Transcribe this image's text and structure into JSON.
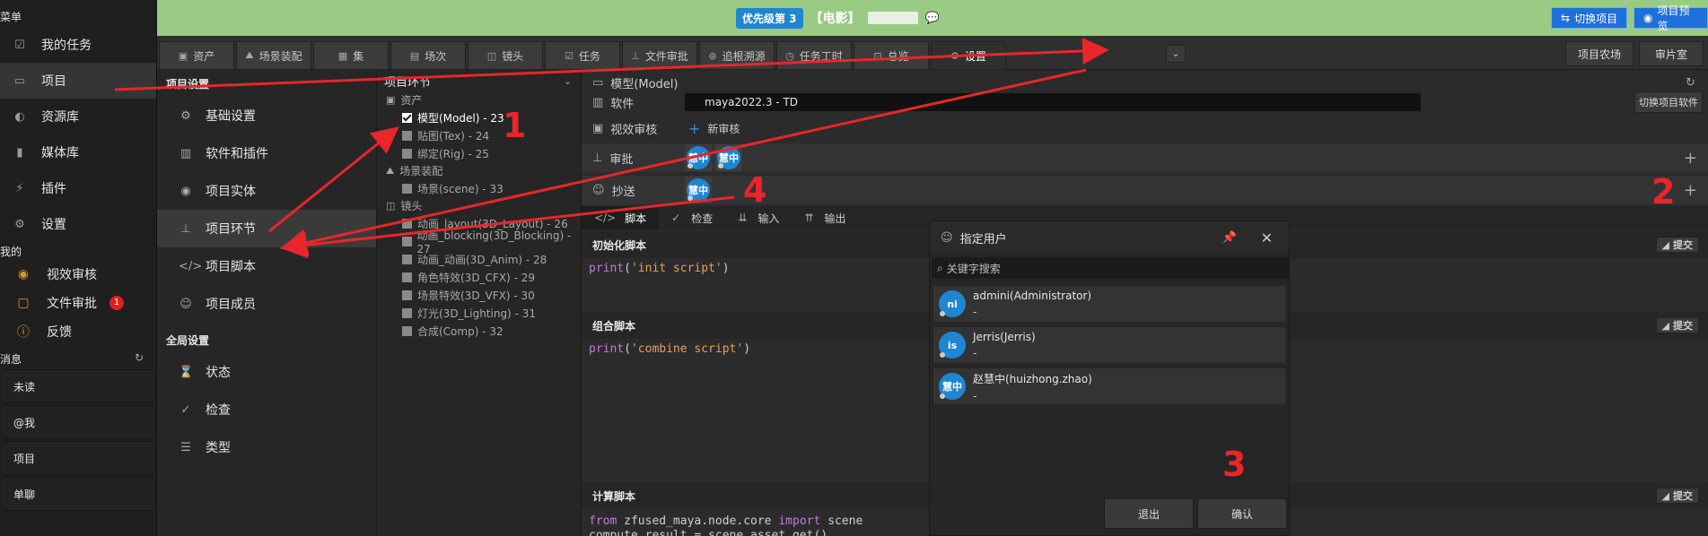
{
  "left_nav": {
    "menu_header": "菜单",
    "items": [
      {
        "label": "我的任务",
        "icon": "checkbox-icon"
      },
      {
        "label": "项目",
        "icon": "window-icon"
      },
      {
        "label": "资源库",
        "icon": "globe-icon"
      },
      {
        "label": "媒体库",
        "icon": "media-icon"
      },
      {
        "label": "插件",
        "icon": "plug-icon"
      },
      {
        "label": "设置",
        "icon": "gear-icon"
      }
    ],
    "mine_header": "我的",
    "mine_items": [
      {
        "label": "视效审核",
        "icon": "eye-icon"
      },
      {
        "label": "文件审批",
        "icon": "folder-icon",
        "badge": "1"
      },
      {
        "label": "反馈",
        "icon": "info-icon"
      }
    ],
    "msg_header": "消息",
    "msg_items": [
      "未读",
      "@我",
      "项目",
      "单聊"
    ]
  },
  "top_bar": {
    "priority_label": "优先级第 3",
    "title": "【电影】",
    "switch_project": "切换项目",
    "project_preview": "项目预览"
  },
  "tabs": [
    {
      "label": "资产",
      "icon": "box-icon"
    },
    {
      "label": "场景装配",
      "icon": "mountain-icon"
    },
    {
      "label": "集",
      "icon": "film-icon"
    },
    {
      "label": "场次",
      "icon": "clapper-icon"
    },
    {
      "label": "镜头",
      "icon": "camera-icon"
    },
    {
      "label": "任务",
      "icon": "check-icon"
    },
    {
      "label": "文件审批",
      "icon": "stamp-icon"
    },
    {
      "label": "追根溯源",
      "icon": "trace-icon"
    },
    {
      "label": "任务工时",
      "icon": "clock-icon"
    },
    {
      "label": "总览",
      "icon": "overview-icon"
    },
    {
      "label": "设置",
      "icon": "gear-icon"
    }
  ],
  "right_buttons": [
    "项目农场",
    "审片室"
  ],
  "settings_panel": {
    "project_header": "项目设置",
    "project_items": [
      {
        "label": "基础设置",
        "icon": "gear-icon"
      },
      {
        "label": "软件和插件",
        "icon": "bar-chart-icon"
      },
      {
        "label": "项目实体",
        "icon": "entity-icon"
      },
      {
        "label": "项目环节",
        "icon": "flow-icon"
      },
      {
        "label": "项目脚本",
        "icon": "code-icon"
      },
      {
        "label": "项目成员",
        "icon": "members-icon"
      }
    ],
    "global_header": "全局设置",
    "global_items": [
      {
        "label": "状态",
        "icon": "hourglass-icon"
      },
      {
        "label": "检查",
        "icon": "check-circle-icon"
      },
      {
        "label": "类型",
        "icon": "list-icon"
      }
    ]
  },
  "phase_tree": {
    "header": "项目环节",
    "groups": [
      {
        "label": "资产",
        "items": [
          "模型(Model) - 23",
          "贴图(Tex) - 24",
          "绑定(Rig) - 25"
        ]
      },
      {
        "label": "场景装配",
        "items": [
          "场景(scene) - 33"
        ]
      },
      {
        "label": "镜头",
        "items": [
          "动画_layout(3D_Layout) - 26",
          "动画_blocking(3D_Blocking) - 27",
          "动画_动画(3D_Anim) - 28",
          "角色特效(3D_CFX) - 29",
          "场景特效(3D_VFX) - 30",
          "灯光(3D_Lighting) - 31",
          "合成(Comp) - 32"
        ]
      }
    ],
    "checked_item": "模型(Model) - 23"
  },
  "main": {
    "header": "模型(Model)",
    "software_label": "软件",
    "software_value": "maya2022.3 - TD",
    "switch_software": "切换项目软件",
    "vfx_review_label": "视效审核",
    "new_review": "新审核",
    "approve_label": "审批",
    "cc_label": "抄送",
    "avatar_text": "慧中",
    "script_tabs": [
      "脚本",
      "检查",
      "输入",
      "输出"
    ],
    "scripts": [
      {
        "title": "初始化脚本",
        "code_fn": "print",
        "code_str": "'init script'"
      },
      {
        "title": "组合脚本",
        "code_fn": "print",
        "code_str": "'combine script'"
      },
      {
        "title": "计算脚本",
        "code_line1_kw1": "from",
        "code_line1_mod": "zfused_maya.node.core",
        "code_line1_kw2": "import",
        "code_line1_name": "scene",
        "code_line2": "compute_result = scene.asset_get()"
      }
    ],
    "submit": "提交"
  },
  "dialog": {
    "title": "指定用户",
    "search_placeholder": "关键字搜索",
    "users": [
      {
        "avatar": "ni",
        "name": "admini(Administrator)",
        "sub": "-"
      },
      {
        "avatar": "is",
        "name": "Jerris(Jerris)",
        "sub": "-"
      },
      {
        "avatar": "慧中",
        "name": "赵慧中(huizhong.zhao)",
        "sub": "-"
      }
    ],
    "exit": "退出",
    "confirm": "确认"
  },
  "annotations": [
    "1",
    "2",
    "3",
    "4"
  ],
  "colors": {
    "accent_blue": "#1f86d1",
    "banner_green": "#9acb84",
    "arrow_red": "#e8262b"
  }
}
